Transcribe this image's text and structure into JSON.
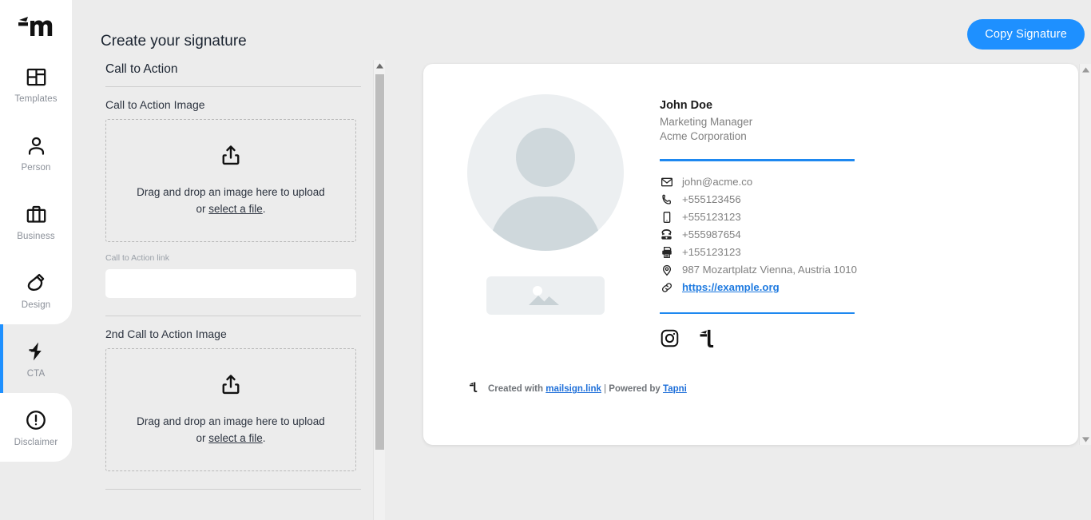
{
  "app": {
    "logo_alt": "mailsign-logo",
    "page_title": "Create your signature"
  },
  "sidebar": {
    "items": [
      {
        "label": "Templates",
        "icon": "templates-icon",
        "active": false
      },
      {
        "label": "Person",
        "icon": "person-icon",
        "active": false
      },
      {
        "label": "Business",
        "icon": "briefcase-icon",
        "active": false
      },
      {
        "label": "Design",
        "icon": "brush-icon",
        "active": false
      },
      {
        "label": "CTA",
        "icon": "bolt-icon",
        "active": true
      },
      {
        "label": "Disclaimer",
        "icon": "alert-circle-icon",
        "active": false
      }
    ],
    "active_accent": "#1e90ff"
  },
  "toolbar": {
    "copy_label": "Copy Signature",
    "copy_color": "#1e90ff"
  },
  "form": {
    "section_title": "Call to Action",
    "cta_image_label": "Call to Action Image",
    "dropzone_line1": "Drag and drop an image here to upload",
    "dropzone_or": "or ",
    "dropzone_link": "select a file",
    "dropzone_period": ".",
    "cta_link_label": "Call to Action link",
    "cta_link_value": "",
    "cta_link_placeholder": "",
    "cta_image2_label": "2nd Call to Action Image"
  },
  "signature": {
    "name": "John Doe",
    "role": "Marketing Manager",
    "company": "Acme Corporation",
    "divider_color": "#1e88f0",
    "contacts": [
      {
        "icon": "envelope-icon",
        "value": "john@acme.co",
        "is_link": false
      },
      {
        "icon": "phone-icon",
        "value": "+555123456",
        "is_link": false
      },
      {
        "icon": "mobile-icon",
        "value": "+555123123",
        "is_link": false
      },
      {
        "icon": "telephone-icon",
        "value": "+555987654",
        "is_link": false
      },
      {
        "icon": "fax-icon",
        "value": "+155123123",
        "is_link": false
      },
      {
        "icon": "location-pin-icon",
        "value": "987 Mozartplatz Vienna, Austria 1010",
        "is_link": false
      },
      {
        "icon": "link-icon",
        "value": "https://example.org",
        "is_link": true
      }
    ],
    "socials": [
      {
        "icon": "instagram-icon",
        "name": "Instagram"
      },
      {
        "icon": "tapni-icon",
        "name": "Tapni"
      }
    ],
    "footer": {
      "icon": "tapni-icon",
      "created_with": "Created with ",
      "brand": "mailsign.link",
      "separator": " | ",
      "powered_by": "Powered by ",
      "powered_brand": "Tapni"
    }
  }
}
